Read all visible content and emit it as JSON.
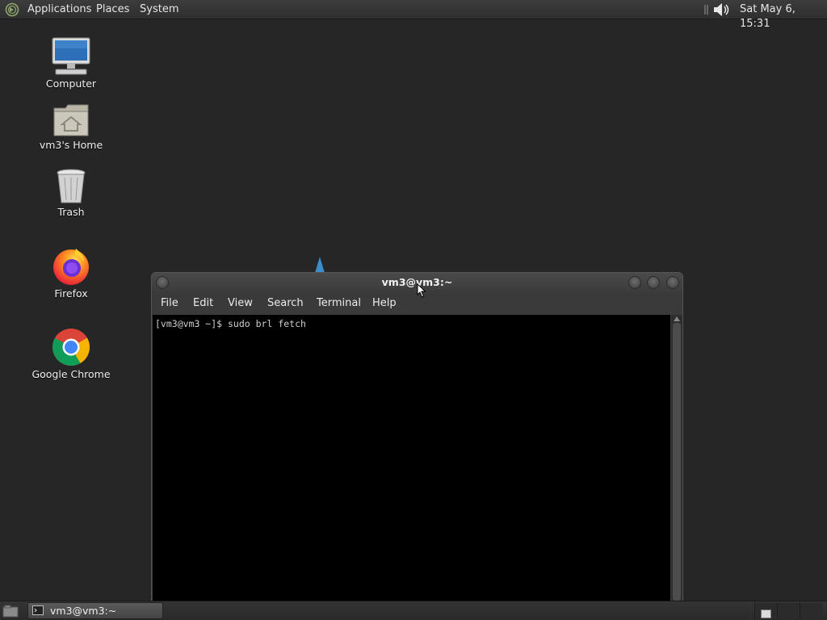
{
  "top_panel": {
    "menus": [
      "Applications",
      "Places",
      "System"
    ],
    "clock": "Sat May  6, 15:31",
    "volume_icon": "speaker-icon"
  },
  "desktop": {
    "icons": [
      {
        "label": "Computer",
        "icon": "computer-icon"
      },
      {
        "label": "vm3's Home",
        "icon": "home-folder-icon"
      },
      {
        "label": "Trash",
        "icon": "trash-icon"
      },
      {
        "label": "Firefox",
        "icon": "firefox-icon"
      },
      {
        "label": "Google Chrome",
        "icon": "chrome-icon"
      }
    ]
  },
  "terminal": {
    "title": "vm3@vm3:~",
    "menu": [
      "File",
      "Edit",
      "View",
      "Search",
      "Terminal",
      "Help"
    ],
    "content": "[vm3@vm3 ~]$ sudo brl fetch"
  },
  "bottom_panel": {
    "task_label": "vm3@vm3:~"
  },
  "colors": {
    "desktop_bg": "#262626",
    "panel_bg": "#333333",
    "terminal_bg": "#000000"
  }
}
